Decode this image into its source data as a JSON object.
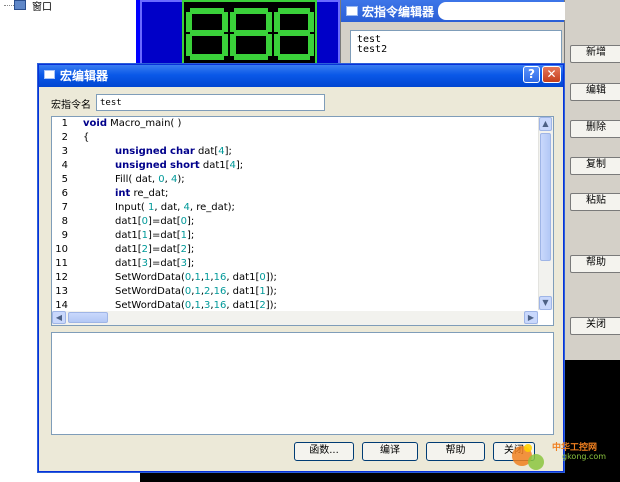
{
  "background": {
    "tree_label": "窗口",
    "macro_list_window": {
      "title": "宏指令编辑器",
      "items": [
        "test",
        "test2"
      ]
    },
    "side_buttons": [
      "新增",
      "编辑",
      "删除",
      "复制",
      "粘贴",
      "帮助",
      "关闭"
    ]
  },
  "editor": {
    "title": "宏编辑器",
    "help_glyph": "?",
    "close_glyph": "✕",
    "name_label": "宏指令名",
    "name_value": "test",
    "code_lines": [
      {
        "n": "1",
        "text": "void Macro_main( )"
      },
      {
        "n": "2",
        "text": "{"
      },
      {
        "n": "3",
        "text": "unsigned char dat[4];"
      },
      {
        "n": "4",
        "text": "unsigned short dat1[4];"
      },
      {
        "n": "5",
        "text": "Fill( dat, 0, 4);"
      },
      {
        "n": "6",
        "text": "int re_dat;"
      },
      {
        "n": "7",
        "text": "Input( 1, dat, 4, re_dat);"
      },
      {
        "n": "8",
        "text": "dat1[0]=dat[0];"
      },
      {
        "n": "9",
        "text": "dat1[1]=dat[1];"
      },
      {
        "n": "10",
        "text": "dat1[2]=dat[2];"
      },
      {
        "n": "11",
        "text": "dat1[3]=dat[3];"
      },
      {
        "n": "12",
        "text": "SetWordData(0,1,1,16, dat1[0]);"
      },
      {
        "n": "13",
        "text": "SetWordData(0,1,2,16, dat1[1]);"
      },
      {
        "n": "14",
        "text": "SetWordData(0,1,3,16, dat1[2]);"
      }
    ],
    "buttons": {
      "functions": "函数...",
      "compile": "编译",
      "help": "帮助",
      "close": "关闭"
    }
  },
  "watermark": {
    "line1": "中华工控网",
    "line2": "gkong.com"
  },
  "colors": {
    "title_bar": "#0a58e8",
    "keyword": "#00008b",
    "number": "#009999",
    "display_blue": "#0000ff",
    "lcd_green": "#3ad13a"
  }
}
